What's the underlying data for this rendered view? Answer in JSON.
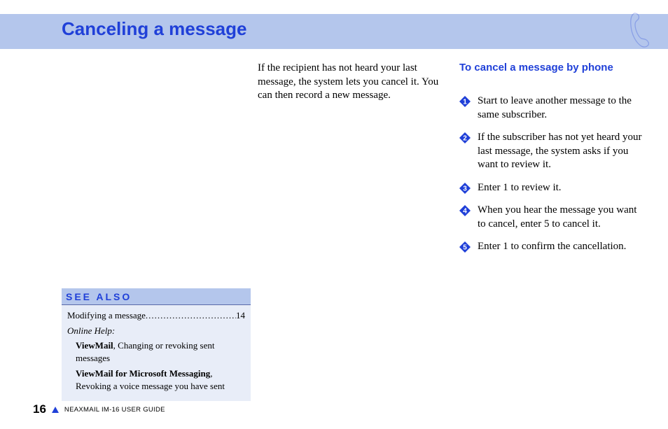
{
  "title": "Canceling a message",
  "intro": "If the recipient has not heard your last message, the system lets you cancel it. You can then record a new message.",
  "procedure": {
    "heading": "To cancel a message by phone",
    "steps": [
      "Start to leave another message to the same subscriber.",
      "If the subscriber has not yet heard your last message, the system asks if you want to review it.",
      "Enter 1 to review it.",
      "When you hear the message you want to cancel, enter 5 to cancel it.",
      "Enter 1 to confirm the cancellation."
    ]
  },
  "see_also": {
    "heading": "SEE ALSO",
    "xref": {
      "label": "Modifying a message",
      "page": "14"
    },
    "online_help_label": "Online Help:",
    "items": [
      {
        "bold": "ViewMail",
        "rest": ", Changing or revoking sent messages"
      },
      {
        "bold": "ViewMail for Microsoft Messaging",
        "rest": ", Revoking a voice message you have sent"
      }
    ]
  },
  "footer": {
    "page": "16",
    "guide": "NEAXMAIL IM-16 USER GUIDE"
  }
}
